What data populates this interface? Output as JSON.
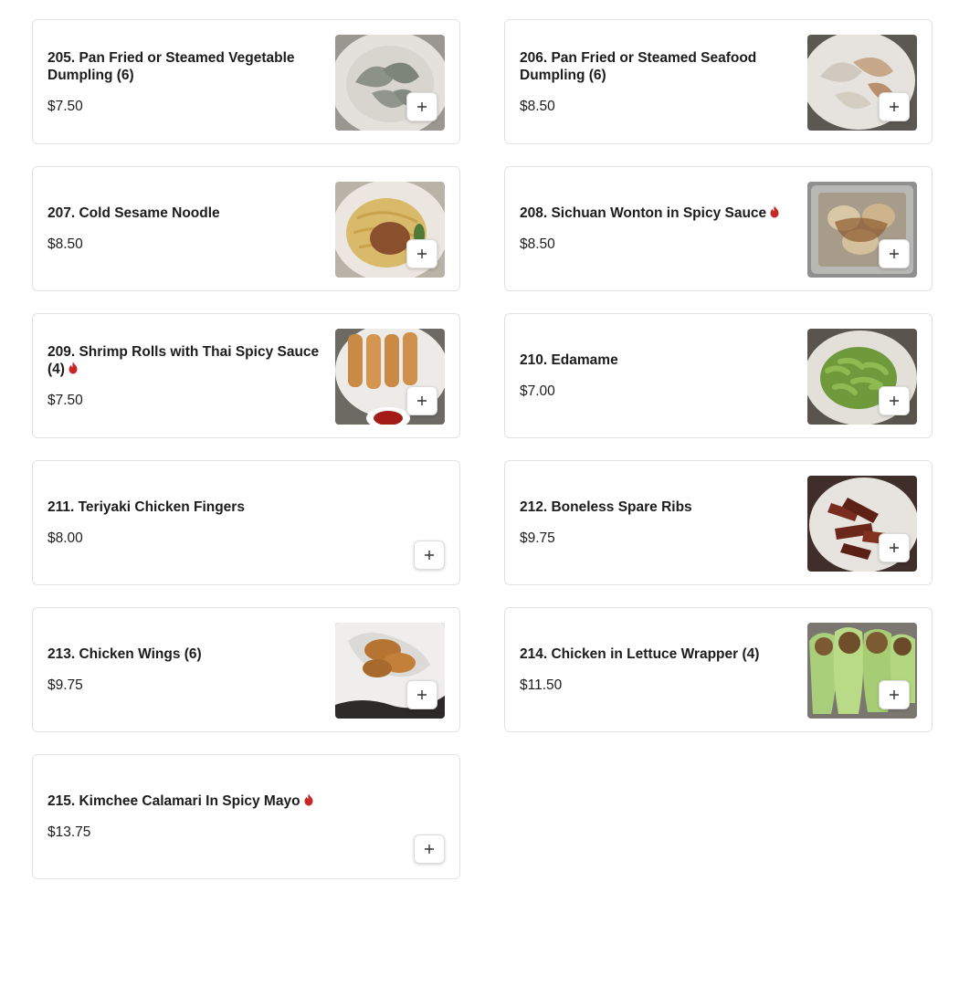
{
  "colors": {
    "spicy": "#c62828",
    "border": "#e2e2e2",
    "text": "#1c1c1c"
  },
  "menu": {
    "items": [
      {
        "name": "205. Pan Fried or Steamed Vegetable Dumpling (6)",
        "price": "$7.50",
        "spicy": false,
        "image": "dumpling-photo"
      },
      {
        "name": "206. Pan Fried or Steamed Seafood Dumpling (6)",
        "price": "$8.50",
        "spicy": false,
        "image": "dumpling-photo"
      },
      {
        "name": "207. Cold Sesame Noodle",
        "price": "$8.50",
        "spicy": false,
        "image": "noodle-photo"
      },
      {
        "name": "208. Sichuan Wonton in Spicy Sauce",
        "price": "$8.50",
        "spicy": true,
        "image": "wonton-photo"
      },
      {
        "name": "209. Shrimp Rolls with Thai Spicy Sauce (4)",
        "price": "$7.50",
        "spicy": true,
        "image": "spring-roll-photo"
      },
      {
        "name": "210. Edamame",
        "price": "$7.00",
        "spicy": false,
        "image": "edamame-photo"
      },
      {
        "name": "211. Teriyaki Chicken Fingers",
        "price": "$8.00",
        "spicy": false,
        "image": null
      },
      {
        "name": "212. Boneless Spare Ribs",
        "price": "$9.75",
        "spicy": false,
        "image": "spare-ribs-photo"
      },
      {
        "name": "213. Chicken Wings (6)",
        "price": "$9.75",
        "spicy": false,
        "image": "chicken-wings-photo"
      },
      {
        "name": "214. Chicken in Lettuce Wrapper (4)",
        "price": "$11.50",
        "spicy": false,
        "image": "lettuce-wrap-photo"
      },
      {
        "name": "215. Kimchee Calamari In Spicy Mayo",
        "price": "$13.75",
        "spicy": true,
        "image": null
      }
    ],
    "add_icon": "plus-icon",
    "spicy_icon": "flame-icon"
  }
}
